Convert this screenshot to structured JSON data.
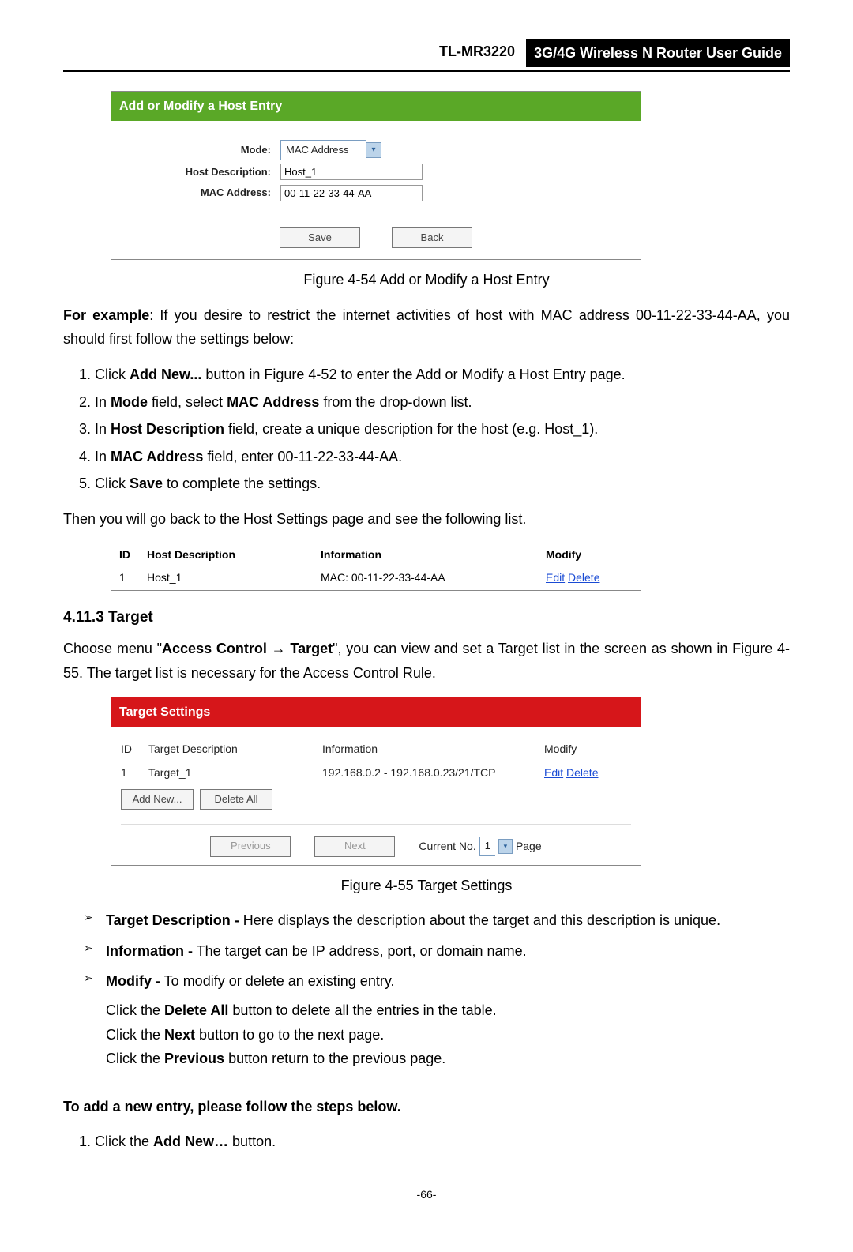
{
  "header": {
    "model": "TL-MR3220",
    "title": "3G/4G Wireless N Router User Guide"
  },
  "fig54": {
    "panel_title": "Add or Modify a Host Entry",
    "labels": {
      "mode": "Mode:",
      "host_desc": "Host Description:",
      "mac": "MAC Address:"
    },
    "values": {
      "mode_option": "MAC Address",
      "host_desc": "Host_1",
      "mac": "00-11-22-33-44-AA"
    },
    "buttons": {
      "save": "Save",
      "back": "Back"
    },
    "caption": "Figure 4-54    Add or Modify a Host Entry"
  },
  "para_for_example_prefix": "For example",
  "para_for_example_rest": ": If you desire to restrict the internet activities of host with MAC address 00-11-22-33-44-AA, you should first follow the settings below:",
  "steps_add_host": {
    "s1a": "Click ",
    "s1b": "Add New...",
    "s1c": " button in Figure 4-52 to enter the Add or Modify a Host Entry page.",
    "s2a": "In ",
    "s2b": "Mode",
    "s2c": " field, select ",
    "s2d": "MAC Address",
    "s2e": " from the drop-down list.",
    "s3a": "In ",
    "s3b": "Host Description",
    "s3c": " field, create a unique description for the host (e.g. Host_1).",
    "s4a": "In ",
    "s4b": "MAC Address",
    "s4c": " field, enter 00-11-22-33-44-AA.",
    "s5a": "Click ",
    "s5b": "Save",
    "s5c": " to complete the settings."
  },
  "para_then": "Then you will go back to the Host Settings page and see the following list.",
  "host_table": {
    "h_id": "ID",
    "h_desc": "Host Description",
    "h_info": "Information",
    "h_mod": "Modify",
    "r_id": "1",
    "r_desc": "Host_1",
    "r_info": "MAC: 00-11-22-33-44-AA",
    "r_edit": "Edit",
    "r_del": "Delete"
  },
  "section_heading": "4.11.3   Target",
  "para_target_intro_a": "Choose menu \"",
  "para_target_intro_b": "Access Control  →  Target",
  "para_target_intro_c": "\", you can view and set a Target list in the screen as shown in Figure 4-55. The target list is necessary for the Access Control Rule.",
  "fig55": {
    "panel_title": "Target Settings",
    "h_id": "ID",
    "h_desc": "Target Description",
    "h_info": "Information",
    "h_mod": "Modify",
    "r_id": "1",
    "r_desc": "Target_1",
    "r_info": "192.168.0.2 - 192.168.0.23/21/TCP",
    "r_edit": "Edit",
    "r_del": "Delete",
    "btn_add": "Add New...",
    "btn_delall": "Delete All",
    "btn_prev": "Previous",
    "btn_next": "Next",
    "curno_label": "Current No.",
    "curno_val": "1",
    "page_label": "Page",
    "caption": "Figure 4-55    Target Settings"
  },
  "bullets": {
    "b1t": "Target Description -",
    "b1r": " Here displays the description about the target and this description is unique.",
    "b2t": "Information -",
    "b2r": " The target can be IP address, port, or domain name.",
    "b3t": "Modify -",
    "b3r": " To modify or delete an existing entry.",
    "b3l1a": "Click the ",
    "b3l1b": "Delete All",
    "b3l1c": " button to delete all the entries in the table.",
    "b3l2a": "Click the ",
    "b3l2b": "Next",
    "b3l2c": " button to go to the next page.",
    "b3l3a": "Click the ",
    "b3l3b": "Previous",
    "b3l3c": " button return to the previous page."
  },
  "add_entry_heading": "To add a new entry, please follow the steps below.",
  "add_entry_step1a": "Click the ",
  "add_entry_step1b": "Add New…",
  "add_entry_step1c": " button.",
  "page_number": "-66-"
}
